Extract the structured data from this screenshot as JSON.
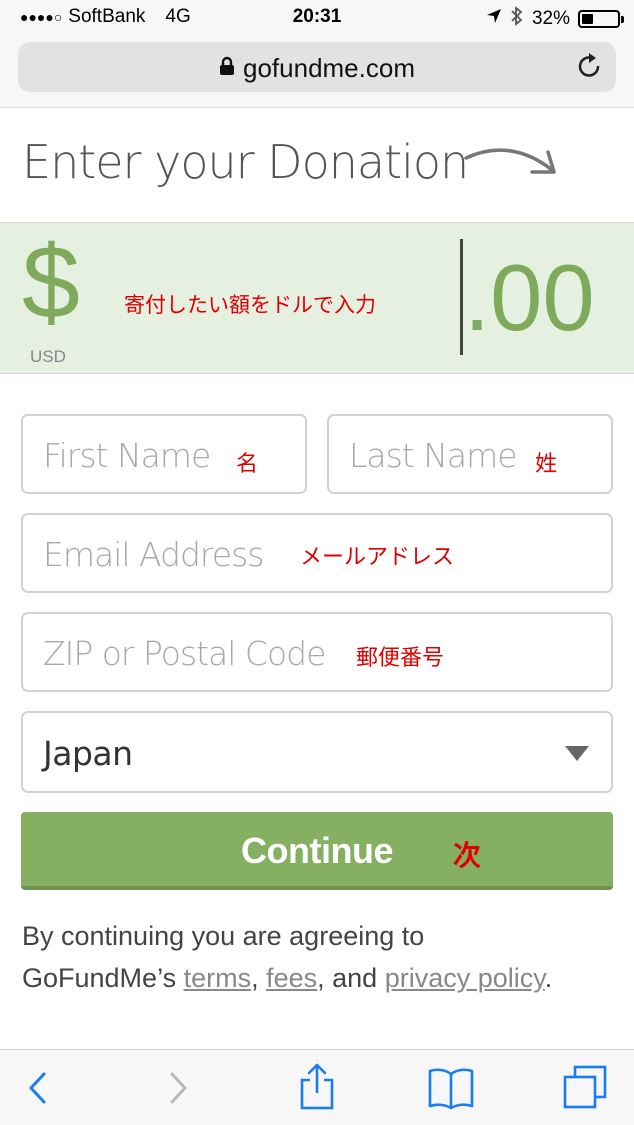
{
  "status_bar": {
    "signal": "●●●●○",
    "carrier": "SoftBank",
    "network": "4G",
    "time": "20:31",
    "battery_percent": "32%",
    "battery_level": 0.32
  },
  "browser": {
    "url": "gofundme.com"
  },
  "heading": "Enter your Donation",
  "amount": {
    "currency_symbol": "$",
    "currency_code": "USD",
    "note": "寄付したい額をドルで入力",
    "cents": ".00"
  },
  "form": {
    "first_name": {
      "placeholder": "First Name",
      "note": "名"
    },
    "last_name": {
      "placeholder": "Last Name",
      "note": "姓"
    },
    "email": {
      "placeholder": "Email Address",
      "note": "メールアドレス"
    },
    "zip": {
      "placeholder": "ZIP or Postal Code",
      "note": "郵便番号"
    },
    "country": {
      "value": "Japan"
    },
    "continue": {
      "label": "Continue",
      "note": "次"
    }
  },
  "legal": {
    "line1": "By continuing you are agreeing to",
    "prefix": "GoFundMe’s ",
    "terms": "terms",
    "sep1": ", ",
    "fees": "fees",
    "sep2": ", and ",
    "privacy": "privacy policy",
    "end": "."
  },
  "colors": {
    "brand_green": "#86b061",
    "amount_bg": "#e6f0e1",
    "annotation_red": "#e00000"
  },
  "icons": [
    "lock-icon",
    "reload-icon",
    "arrow-icon",
    "caret-icon",
    "back-icon",
    "forward-icon",
    "share-icon",
    "bookmarks-icon",
    "tabs-icon"
  ]
}
